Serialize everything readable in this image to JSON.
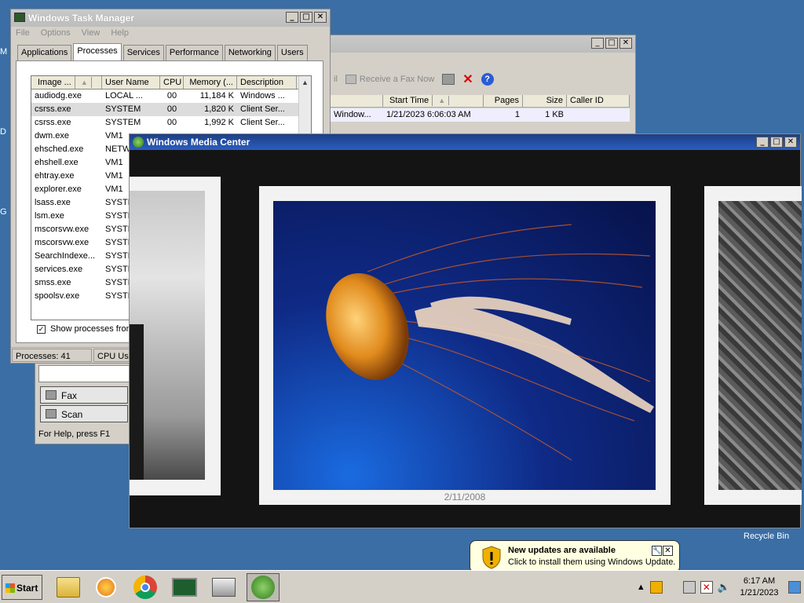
{
  "desktop": {
    "edge_letters": [
      "M",
      "D",
      "G"
    ],
    "recycle_bin": "Recycle Bin"
  },
  "task_manager": {
    "title": "Windows Task Manager",
    "menu": [
      "File",
      "Options",
      "View",
      "Help"
    ],
    "tabs": [
      "Applications",
      "Processes",
      "Services",
      "Performance",
      "Networking",
      "Users"
    ],
    "active_tab": "Processes",
    "columns": [
      "Image ...",
      "User Name",
      "CPU",
      "Memory (...",
      "Description"
    ],
    "rows": [
      {
        "image": "audiodg.exe",
        "user": "LOCAL ...",
        "cpu": "00",
        "mem": "11,184 K",
        "desc": "Windows ..."
      },
      {
        "image": "csrss.exe",
        "user": "SYSTEM",
        "cpu": "00",
        "mem": "1,820 K",
        "desc": "Client Ser..."
      },
      {
        "image": "csrss.exe",
        "user": "SYSTEM",
        "cpu": "00",
        "mem": "1,992 K",
        "desc": "Client Ser..."
      },
      {
        "image": "dwm.exe",
        "user": "VM1",
        "cpu": "",
        "mem": "",
        "desc": ""
      },
      {
        "image": "ehsched.exe",
        "user": "NETW",
        "cpu": "",
        "mem": "",
        "desc": ""
      },
      {
        "image": "ehshell.exe",
        "user": "VM1",
        "cpu": "",
        "mem": "",
        "desc": ""
      },
      {
        "image": "ehtray.exe",
        "user": "VM1",
        "cpu": "",
        "mem": "",
        "desc": ""
      },
      {
        "image": "explorer.exe",
        "user": "VM1",
        "cpu": "",
        "mem": "",
        "desc": ""
      },
      {
        "image": "lsass.exe",
        "user": "SYSTE",
        "cpu": "",
        "mem": "",
        "desc": ""
      },
      {
        "image": "lsm.exe",
        "user": "SYSTE",
        "cpu": "",
        "mem": "",
        "desc": ""
      },
      {
        "image": "mscorsvw.exe",
        "user": "SYSTE",
        "cpu": "",
        "mem": "",
        "desc": ""
      },
      {
        "image": "mscorsvw.exe",
        "user": "SYSTE",
        "cpu": "",
        "mem": "",
        "desc": ""
      },
      {
        "image": "SearchIndexe...",
        "user": "SYSTE",
        "cpu": "",
        "mem": "",
        "desc": ""
      },
      {
        "image": "services.exe",
        "user": "SYSTE",
        "cpu": "",
        "mem": "",
        "desc": ""
      },
      {
        "image": "smss.exe",
        "user": "SYSTE",
        "cpu": "",
        "mem": "",
        "desc": ""
      },
      {
        "image": "spoolsv.exe",
        "user": "SYSTE",
        "cpu": "",
        "mem": "",
        "desc": ""
      }
    ],
    "show_processes_label": "Show processes from a",
    "status_processes": "Processes: 41",
    "status_cpu": "CPU Usa"
  },
  "fax": {
    "toolbar_left": "il",
    "receive_label": "Receive a Fax Now",
    "columns": [
      "",
      "Start Time",
      "Pages",
      "Size",
      "Caller ID"
    ],
    "row": {
      "name": "Window...",
      "start": "1/21/2023 6:06:03 AM",
      "pages": "1",
      "size": "1 KB",
      "caller": ""
    },
    "nav_fax": "Fax",
    "nav_scan": "Scan",
    "help": "For Help, press F1"
  },
  "media_center": {
    "title": "Windows Media Center",
    "photo_date": "2/11/2008"
  },
  "balloon": {
    "title": "New updates are available",
    "text": "Click to install them using Windows Update."
  },
  "taskbar": {
    "start_label": "Start",
    "time": "6:17 AM",
    "date": "1/21/2023"
  },
  "colors": {
    "desktop": "#3a6ea5",
    "wmc_title": "#2b5dbf",
    "jelly_bg": "#0f2a86"
  }
}
